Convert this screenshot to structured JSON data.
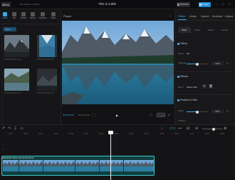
{
  "topbar": {
    "menu_label": "Menu",
    "autosave": "Auto saved: 12:25:33",
    "project_title": "This is a title",
    "shortcut_label": "Shortcut",
    "export_label": "Export"
  },
  "media": {
    "tools": [
      {
        "label": "Media",
        "icon": "media-icon"
      },
      {
        "label": "Text",
        "icon": "text-icon"
      },
      {
        "label": "Stickers",
        "icon": "stickers-icon"
      },
      {
        "label": "Effects",
        "icon": "effects-icon"
      },
      {
        "label": "Transition",
        "icon": "transition-icon"
      },
      {
        "label": "Filters",
        "icon": "filters-icon"
      }
    ],
    "import_label": "Import",
    "thumbnails": [
      {
        "name": "20231024-0001.mp4"
      },
      {
        "name": "20231024-0002.mp4"
      },
      {
        "name": "20231024-0003.mp4"
      },
      {
        "name": "20231024-0004.mp4"
      }
    ]
  },
  "player": {
    "title": "Player",
    "current_time": "00:00:05:26",
    "duration": "00:00:32:16",
    "original_label": "Original"
  },
  "right_panel": {
    "tabs": [
      "Video",
      "Audio",
      "Speed",
      "Animate",
      "Adjust"
    ],
    "active_tab": "Video",
    "subtabs": [
      "Basic",
      "Cutout",
      "Mask",
      "Canvas"
    ],
    "active_subtab": "Basic",
    "filters_heading": "Filters",
    "filter_name_label": "Name",
    "filter_name": "Mix",
    "filter_strength_label": "Strength",
    "filter_strength": "50%",
    "filter_strength_value": 0.5,
    "effects_heading": "Effects",
    "effect_label": "EFCT",
    "effect_name": "Motion Blur",
    "position_heading": "Position & Size",
    "scale_label": "Scale",
    "scale_value": "50%",
    "scale_fraction": 0.5,
    "position_label": "Position"
  },
  "timeline": {
    "ticks": [
      "00:00",
      "00:02",
      "00:04",
      "00:06",
      "00:08",
      "00:10",
      "00:12",
      "00:14",
      "00:16",
      "00:18",
      "00:20",
      "00:22",
      "00:24",
      "00:26",
      "00:28"
    ],
    "clip_label": "20231024-0003.mp4  00:00:32:16"
  },
  "colors": {
    "accent": "#1f8ad6",
    "clip_border": "#3ec8c8"
  }
}
